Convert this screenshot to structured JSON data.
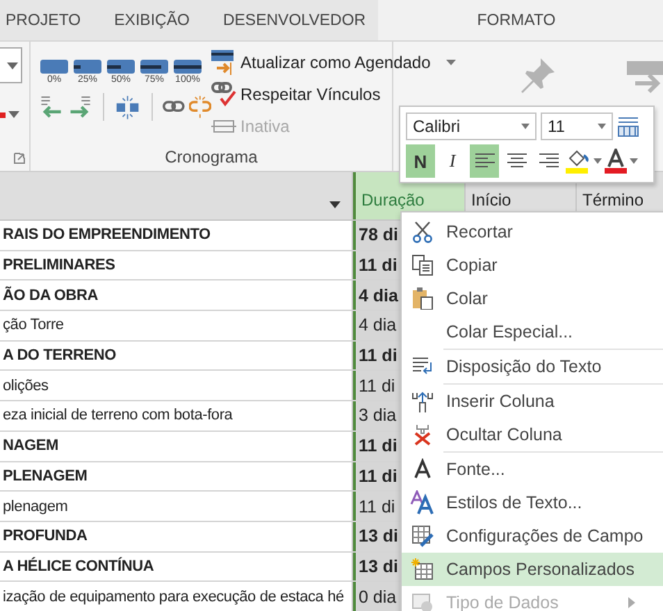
{
  "tabs": [
    {
      "label": "PROJETO",
      "contextual": false
    },
    {
      "label": "EXIBIÇÃO",
      "contextual": false
    },
    {
      "label": "DESENVOLVEDOR",
      "contextual": false
    },
    {
      "label": "FORMATO",
      "contextual": true
    }
  ],
  "ribbon": {
    "progress_buttons": [
      "0%",
      "25%",
      "50%",
      "75%",
      "100%"
    ],
    "commands": [
      {
        "label": "Atualizar como Agendado",
        "disabled": false,
        "dropdown": true
      },
      {
        "label": "Respeitar Vínculos",
        "disabled": false,
        "dropdown": false
      },
      {
        "label": "Inativa",
        "disabled": true,
        "dropdown": false
      }
    ],
    "group_label": "Cronograma"
  },
  "mini_toolbar": {
    "font": "Calibri",
    "size": "11",
    "bold": {
      "label": "N",
      "selected": true
    },
    "italic": {
      "label": "I",
      "selected": false
    },
    "align": [
      {
        "selected": true
      },
      {
        "selected": false
      },
      {
        "selected": false
      }
    ]
  },
  "table": {
    "columns": [
      {
        "label": "Duração",
        "selected": true
      },
      {
        "label": "Início",
        "selected": false
      },
      {
        "label": "Término",
        "selected": false
      }
    ],
    "rows": [
      {
        "name": "RAIS DO EMPREENDIMENTO",
        "duration": "78 di",
        "summary": true
      },
      {
        "name": " PRELIMINARES",
        "duration": "11 di",
        "summary": true
      },
      {
        "name": "ÃO DA OBRA",
        "duration": "4 dia",
        "summary": true
      },
      {
        "name": "ção Torre",
        "duration": "4 dia",
        "summary": false
      },
      {
        "name": "A DO TERRENO",
        "duration": "11 di",
        "summary": true
      },
      {
        "name": "olições",
        "duration": "11 di",
        "summary": false
      },
      {
        "name": "eza inicial de terreno com bota-fora",
        "duration": "3 dia",
        "summary": false
      },
      {
        "name": "NAGEM",
        "duration": "11 di",
        "summary": true
      },
      {
        "name": "PLENAGEM",
        "duration": "11 di",
        "summary": true
      },
      {
        "name": "plenagem",
        "duration": "11 di",
        "summary": false
      },
      {
        "name": " PROFUNDA",
        "duration": "13 di",
        "summary": true
      },
      {
        "name": "A HÉLICE CONTÍNUA",
        "duration": "13 di",
        "summary": true
      },
      {
        "name": "ização de equipamento para execução de estaca hé",
        "duration": "0 dia",
        "summary": false
      }
    ]
  },
  "context_menu": {
    "groups": [
      [
        {
          "label": "Recortar",
          "selected": false,
          "disabled": false,
          "submenu": false
        },
        {
          "label": "Copiar",
          "selected": false,
          "disabled": false,
          "submenu": false
        },
        {
          "label": "Colar",
          "selected": false,
          "disabled": false,
          "submenu": false
        },
        {
          "label": "Colar Especial...",
          "selected": false,
          "disabled": false,
          "submenu": false
        }
      ],
      [
        {
          "label": "Disposição do Texto",
          "selected": false,
          "disabled": false,
          "submenu": false
        }
      ],
      [
        {
          "label": "Inserir Coluna",
          "selected": false,
          "disabled": false,
          "submenu": false
        },
        {
          "label": "Ocultar Coluna",
          "selected": false,
          "disabled": false,
          "submenu": false
        }
      ],
      [
        {
          "label": "Fonte...",
          "selected": false,
          "disabled": false,
          "submenu": false
        },
        {
          "label": "Estilos de Texto...",
          "selected": false,
          "disabled": false,
          "submenu": false
        },
        {
          "label": "Configurações de Campo",
          "selected": false,
          "disabled": false,
          "submenu": false
        },
        {
          "label": "Campos Personalizados",
          "selected": true,
          "disabled": false,
          "submenu": false
        },
        {
          "label": "Tipo de Dados",
          "selected": false,
          "disabled": true,
          "submenu": true
        }
      ]
    ]
  }
}
